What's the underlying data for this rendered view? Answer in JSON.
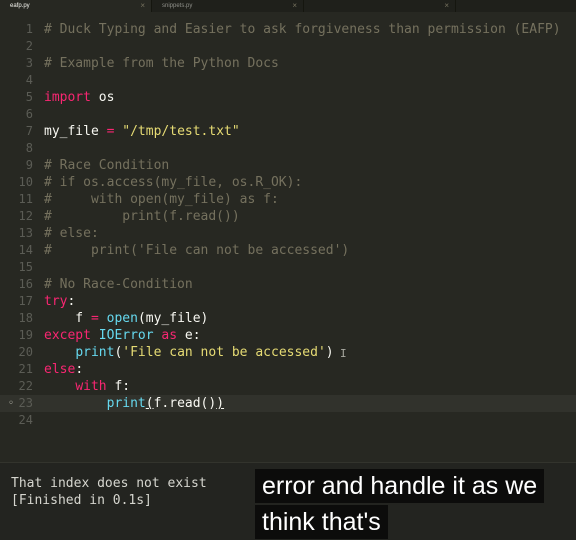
{
  "tabs": [
    {
      "label": "eafp.py",
      "active": true
    },
    {
      "label": "snippets.py",
      "active": false
    },
    {
      "label": "",
      "active": false
    }
  ],
  "close_glyph": "×",
  "editor": {
    "lines": [
      {
        "num": "1",
        "tokens": [
          {
            "t": "# Duck Typing and Easier to ask forgiveness than permission (EAFP)",
            "c": "c"
          }
        ]
      },
      {
        "num": "2",
        "tokens": []
      },
      {
        "num": "3",
        "tokens": [
          {
            "t": "# Example from the Python Docs",
            "c": "c"
          }
        ]
      },
      {
        "num": "4",
        "tokens": []
      },
      {
        "num": "5",
        "tokens": [
          {
            "t": "import",
            "c": "k"
          },
          {
            "t": " os",
            "c": "n"
          }
        ]
      },
      {
        "num": "6",
        "tokens": []
      },
      {
        "num": "7",
        "tokens": [
          {
            "t": "my_file ",
            "c": "n"
          },
          {
            "t": "=",
            "c": "k"
          },
          {
            "t": " ",
            "c": "n"
          },
          {
            "t": "\"/tmp/test.txt\"",
            "c": "s"
          }
        ]
      },
      {
        "num": "8",
        "tokens": []
      },
      {
        "num": "9",
        "tokens": [
          {
            "t": "# Race Condition",
            "c": "c"
          }
        ]
      },
      {
        "num": "10",
        "tokens": [
          {
            "t": "# if os.access(my_file, os.R_OK):",
            "c": "c"
          }
        ]
      },
      {
        "num": "11",
        "tokens": [
          {
            "t": "#     with open(my_file) as f:",
            "c": "c"
          }
        ]
      },
      {
        "num": "12",
        "tokens": [
          {
            "t": "#         print(f.read())",
            "c": "c"
          }
        ]
      },
      {
        "num": "13",
        "tokens": [
          {
            "t": "# else:",
            "c": "c"
          }
        ]
      },
      {
        "num": "14",
        "tokens": [
          {
            "t": "#     print('File can not be accessed')",
            "c": "c"
          }
        ]
      },
      {
        "num": "15",
        "tokens": []
      },
      {
        "num": "16",
        "tokens": [
          {
            "t": "# No Race-Condition",
            "c": "c"
          }
        ]
      },
      {
        "num": "17",
        "tokens": [
          {
            "t": "try",
            "c": "k"
          },
          {
            "t": ":",
            "c": "p"
          }
        ]
      },
      {
        "num": "18",
        "tokens": [
          {
            "t": "    f ",
            "c": "n"
          },
          {
            "t": "=",
            "c": "k"
          },
          {
            "t": " ",
            "c": "n"
          },
          {
            "t": "open",
            "c": "b"
          },
          {
            "t": "(my_file)",
            "c": "n"
          }
        ]
      },
      {
        "num": "19",
        "tokens": [
          {
            "t": "except",
            "c": "k"
          },
          {
            "t": " ",
            "c": "n"
          },
          {
            "t": "IOError",
            "c": "b"
          },
          {
            "t": " ",
            "c": "n"
          },
          {
            "t": "as",
            "c": "k"
          },
          {
            "t": " e:",
            "c": "n"
          }
        ]
      },
      {
        "num": "20",
        "tokens": [
          {
            "t": "    ",
            "c": "n"
          },
          {
            "t": "print",
            "c": "b"
          },
          {
            "t": "(",
            "c": "n"
          },
          {
            "t": "'File can not be accessed'",
            "c": "s"
          },
          {
            "t": ")",
            "c": "n"
          }
        ]
      },
      {
        "num": "21",
        "tokens": [
          {
            "t": "else",
            "c": "k"
          },
          {
            "t": ":",
            "c": "p"
          }
        ]
      },
      {
        "num": "22",
        "tokens": [
          {
            "t": "    ",
            "c": "n"
          },
          {
            "t": "with",
            "c": "k"
          },
          {
            "t": " f:",
            "c": "n"
          }
        ]
      },
      {
        "num": "23",
        "tokens": [
          {
            "t": "        ",
            "c": "n"
          },
          {
            "t": "print",
            "c": "b"
          },
          {
            "t": "(",
            "c": "n u"
          },
          {
            "t": "f.read()",
            "c": "n"
          },
          {
            "t": ")",
            "c": "n u"
          }
        ],
        "current": true,
        "marker": "◦"
      },
      {
        "num": "24",
        "tokens": []
      }
    ],
    "cursor_glyph": "I"
  },
  "console": {
    "lines": [
      "That index does not exist",
      "[Finished in 0.1s]"
    ]
  },
  "captions": [
    "error and handle it as we",
    "think that's"
  ],
  "colors": {
    "background": "#272822",
    "comment": "#75715e",
    "keyword": "#f92672",
    "string": "#e6db74",
    "builtin": "#66d9ef",
    "text": "#f8f8f2"
  }
}
